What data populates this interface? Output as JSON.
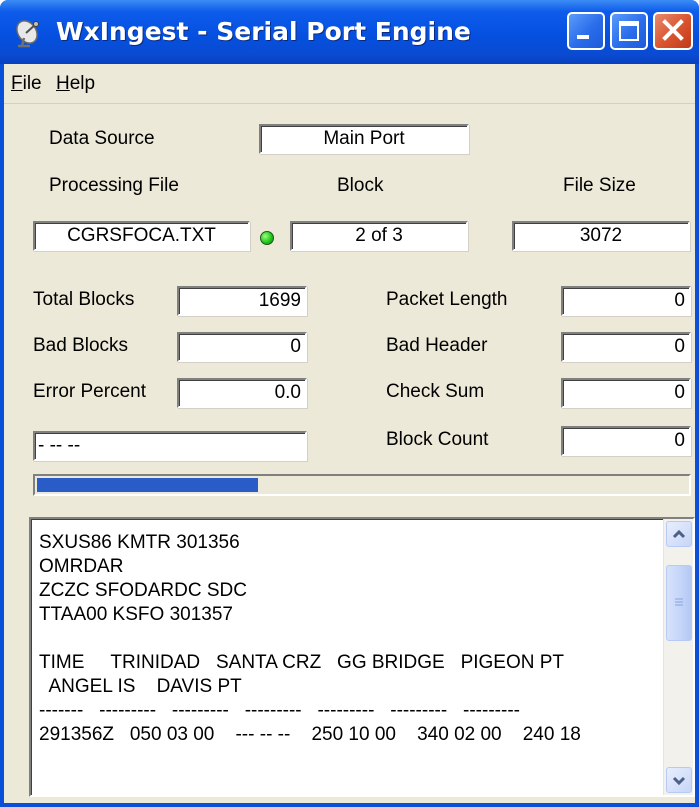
{
  "window": {
    "title": "WxIngest - Serial Port Engine",
    "icon": "satellite-dish-icon"
  },
  "menu": {
    "file": {
      "accel": "F",
      "rest": "ile"
    },
    "help": {
      "accel": "H",
      "rest": "elp"
    }
  },
  "data_source": {
    "label": "Data Source",
    "value": "Main Port"
  },
  "headers": {
    "processing_file": "Processing File",
    "block": "Block",
    "file_size": "File Size"
  },
  "processing": {
    "file": "CGRSFOCA.TXT",
    "status_led": "green",
    "block": "2 of 3",
    "file_size": "3072"
  },
  "stats_left": [
    {
      "label": "Total Blocks",
      "value": "1699"
    },
    {
      "label": "Bad Blocks",
      "value": "0"
    },
    {
      "label": "Error Percent",
      "value": "0.0"
    }
  ],
  "status_field": "- -- --",
  "stats_right": [
    {
      "label": "Packet Length",
      "value": "0"
    },
    {
      "label": "Bad Header",
      "value": "0"
    },
    {
      "label": "Check Sum",
      "value": "0"
    },
    {
      "label": "Block Count",
      "value": "0"
    }
  ],
  "progress": {
    "fraction": 0.34
  },
  "log_lines": [
    "SXUS86 KMTR 301356",
    "OMRDAR",
    "ZCZC SFODARDC SDC",
    "TTAA00 KSFO 301357",
    "",
    "TIME     TRINIDAD   SANTA CRZ   GG BRIDGE   PIGEON PT",
    "  ANGEL IS    DAVIS PT",
    "-------   ---------   ---------   ---------   ---------   ---------   ---------",
    "291356Z   050 03 00    --- -- --    250 10 00    340 02 00    240 18"
  ],
  "colors": {
    "titlebar": "#0550E0",
    "client": "#ECE9D8",
    "progress_fill": "#2A5CC8",
    "close_button": "#D8532E"
  }
}
